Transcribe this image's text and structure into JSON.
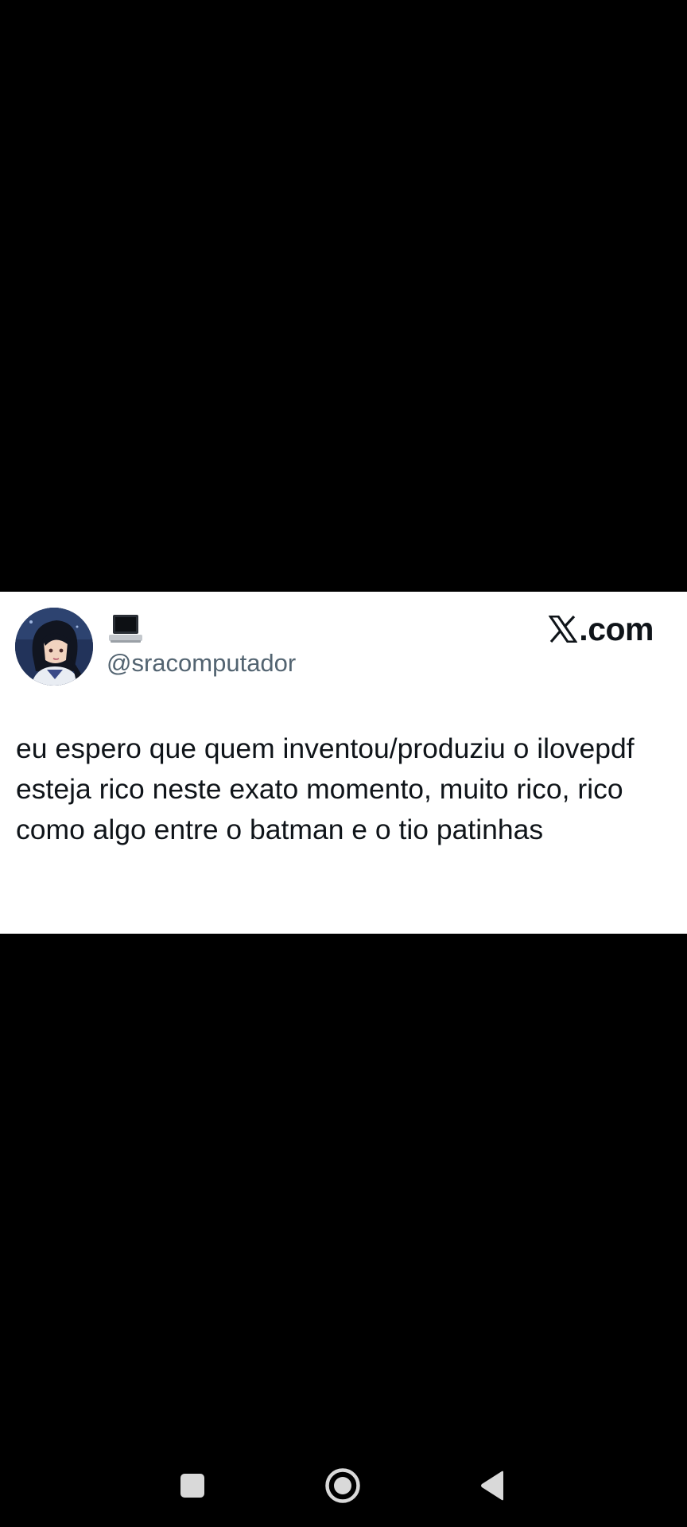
{
  "tweet": {
    "handle": "@sracomputador",
    "name_emoji_icon": "laptop-icon",
    "brand": "X.com",
    "brand_suffix": ".com",
    "text": "eu espero que quem inventou/produziu o ilovepdf esteja rico neste exato momento, muito rico, rico como algo entre o batman e o tio patinhas"
  },
  "nav": {
    "recents_icon": "square-icon",
    "home_icon": "circle-home-icon",
    "back_icon": "triangle-back-icon"
  },
  "colors": {
    "background": "#000000",
    "card": "#ffffff",
    "text": "#0f1419",
    "handle": "#536471",
    "nav_icons": "#d9d9d9"
  }
}
